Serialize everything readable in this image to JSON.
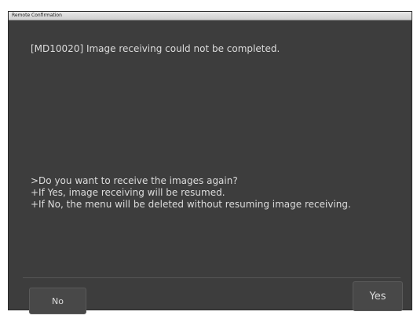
{
  "window": {
    "title": "Remote Confirmation"
  },
  "dialog": {
    "message": "[MD10020] Image receiving could not be completed.",
    "prompt_lines": [
      ">Do you want to receive the images again?",
      "+If Yes, image receiving will be resumed.",
      "+If No, the menu will be deleted without resuming image receiving."
    ]
  },
  "buttons": {
    "no_label": "No",
    "yes_label": "Yes"
  },
  "colors": {
    "dialog_background": "#3d3d3d",
    "text": "#dcdcdc",
    "button_background": "#484848"
  }
}
